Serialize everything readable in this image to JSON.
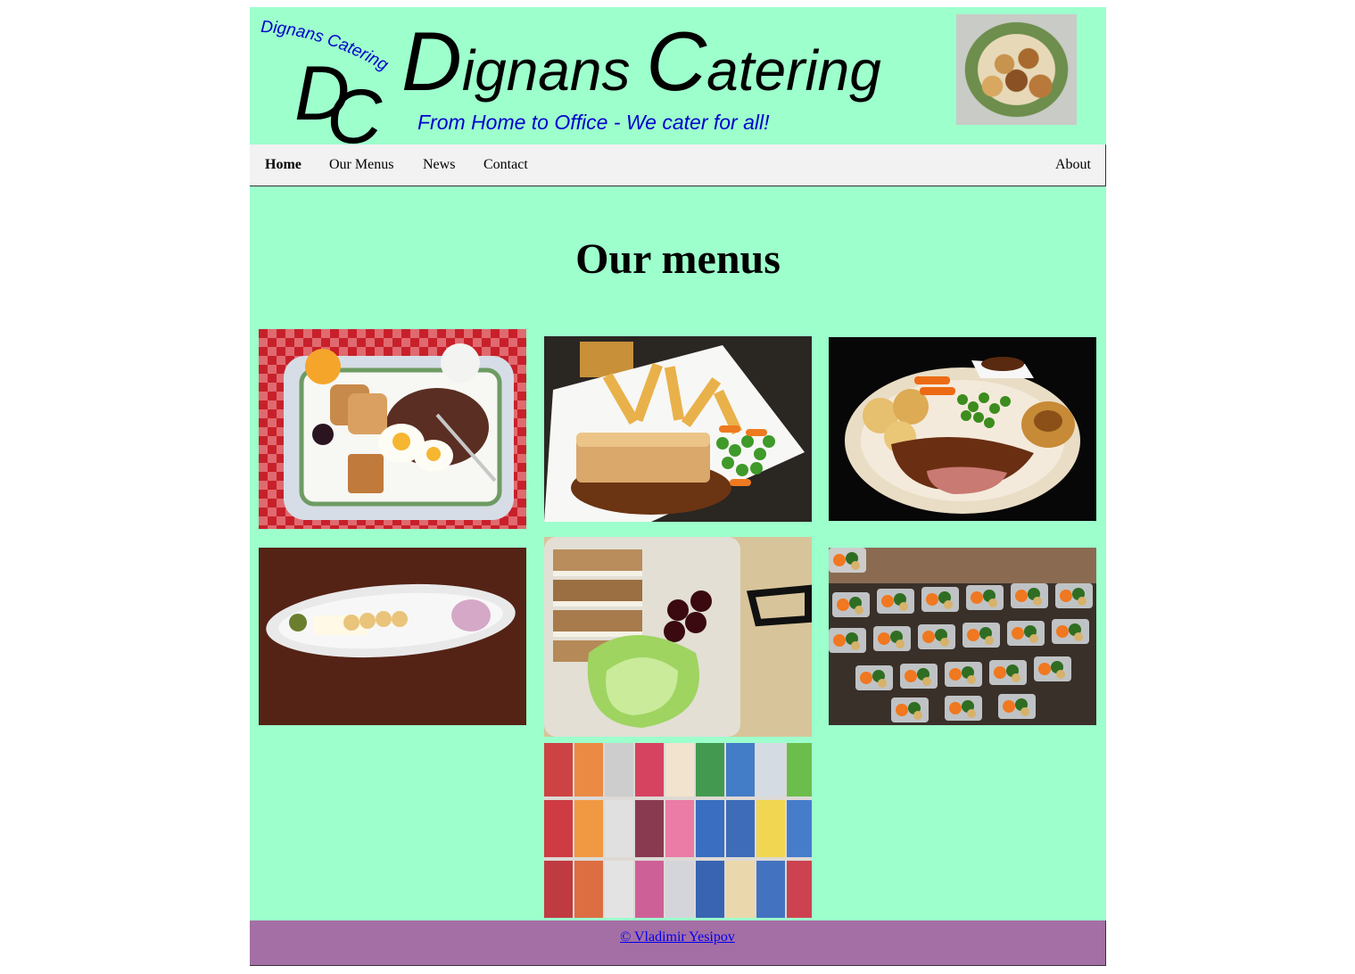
{
  "header": {
    "logo_arc_text": "Dignans Catering",
    "logo_letters": [
      "D",
      "C"
    ],
    "title_first_cap": "D",
    "title_first_rest": "ignans ",
    "title_second_cap": "C",
    "title_second_rest": "atering",
    "tagline": "From Home to Office - We cater for all!",
    "photo_alt": "Plate of roasted potatoes"
  },
  "nav": {
    "items": [
      {
        "label": "Home",
        "active": true
      },
      {
        "label": "Our Menus",
        "active": false
      },
      {
        "label": "News",
        "active": false
      },
      {
        "label": "Contact",
        "active": false
      }
    ],
    "right_item": "About"
  },
  "main": {
    "heading": "Our menus",
    "tiles": [
      {
        "name": "breakfast-menu-image",
        "alt": "Breakfast tray on checkered tablecloth"
      },
      {
        "name": "pie-menu-image",
        "alt": "Pie with chips and vegetables"
      },
      {
        "name": "roast-menu-image",
        "alt": "Roast dinner with yorkshire pudding"
      },
      {
        "name": "dessert-menu-image",
        "alt": "Plated starter on long dish"
      },
      {
        "name": "lunchbox-menu-image",
        "alt": "Sandwich lunchbox with salad and cherries"
      },
      {
        "name": "meal-prep-menu-image",
        "alt": "Meal prep containers"
      },
      {
        "name": "drinks-menu-image",
        "alt": "Soft drink cans"
      }
    ]
  },
  "footer": {
    "credit": "© Vladimir Yesipov"
  },
  "colors": {
    "background": "#9dffcc",
    "nav": "#f2f2f2",
    "footer": "#a46fa5",
    "tagline": "#0000cc"
  }
}
